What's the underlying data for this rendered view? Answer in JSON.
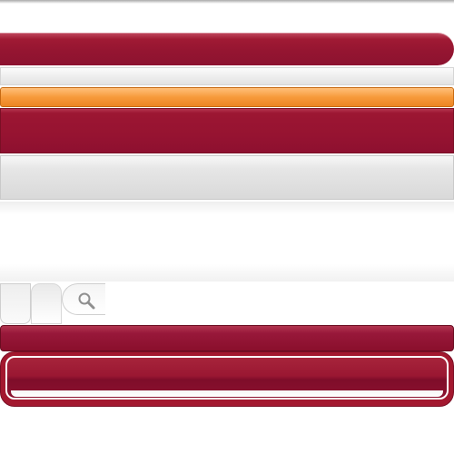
{
  "ui": {
    "components": [
      "header-bar",
      "toolbar-strip",
      "highlight-strip",
      "navigation-bar",
      "content-header",
      "content-panel",
      "tab-left",
      "tab-middle",
      "search-field",
      "dark-bar",
      "footer-frame"
    ],
    "search": {
      "icon": "search-icon",
      "placeholder": ""
    },
    "colors": {
      "crimson": "#951531",
      "orange": "#f79a3b",
      "light_gray": "#e2e2e2",
      "white": "#ffffff"
    }
  }
}
